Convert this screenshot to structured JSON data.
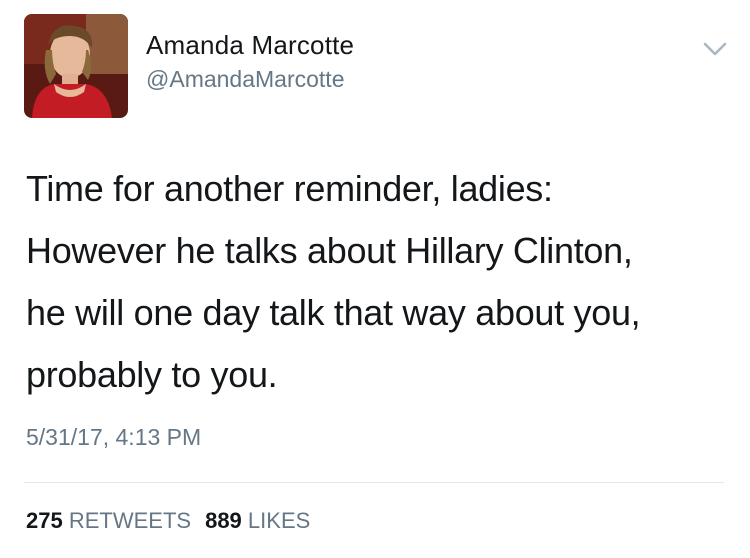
{
  "author": {
    "display_name": "Amanda Marcotte",
    "handle": "@AmandaMarcotte",
    "avatar_icon": "profile-photo"
  },
  "menu_icon": "chevron-down-icon",
  "tweet": {
    "lines": [
      "Time for another reminder, ladies:",
      "However he talks about Hillary Clinton,",
      "he will one day talk that way about you,",
      "probably to you."
    ],
    "timestamp": "5/31/17, 4:13 PM"
  },
  "stats": {
    "retweets_count": "275",
    "retweets_label": "RETWEETS",
    "likes_count": "889",
    "likes_label": "LIKES"
  },
  "colors": {
    "text_primary": "#14171a",
    "text_secondary": "#657786",
    "divider": "#e1e8ed"
  }
}
